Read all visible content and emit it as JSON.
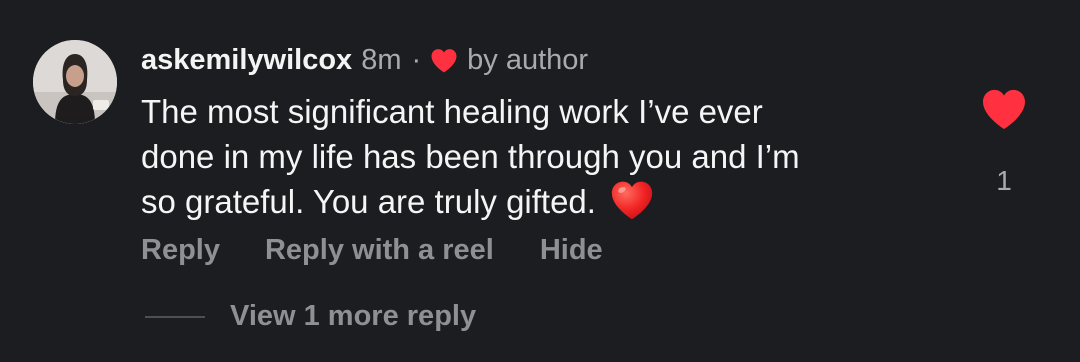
{
  "comment": {
    "username": "askemilywilcox",
    "timestamp": "8m",
    "separator": "·",
    "author_badge": "by author",
    "author_badge_icon": "heart-icon",
    "text_lines": [
      "The most significant healing work I’ve ever",
      "done in my life has been through you and I’m",
      "so grateful. You are truly gifted."
    ],
    "inline_emoji": "red-heart-emoji",
    "like_count": "1",
    "like_icon": "heart-filled-icon",
    "liked": true
  },
  "actions": {
    "reply_label": "Reply",
    "reply_reel_label": "Reply with a reel",
    "hide_label": "Hide"
  },
  "replies": {
    "view_more_label": "View 1 more reply"
  },
  "colors": {
    "background": "#1b1d20",
    "primary_text": "#f5f5f5",
    "secondary_text": "#a9aaad",
    "action_text": "#8e9094",
    "heart_red": "#ff3040"
  }
}
